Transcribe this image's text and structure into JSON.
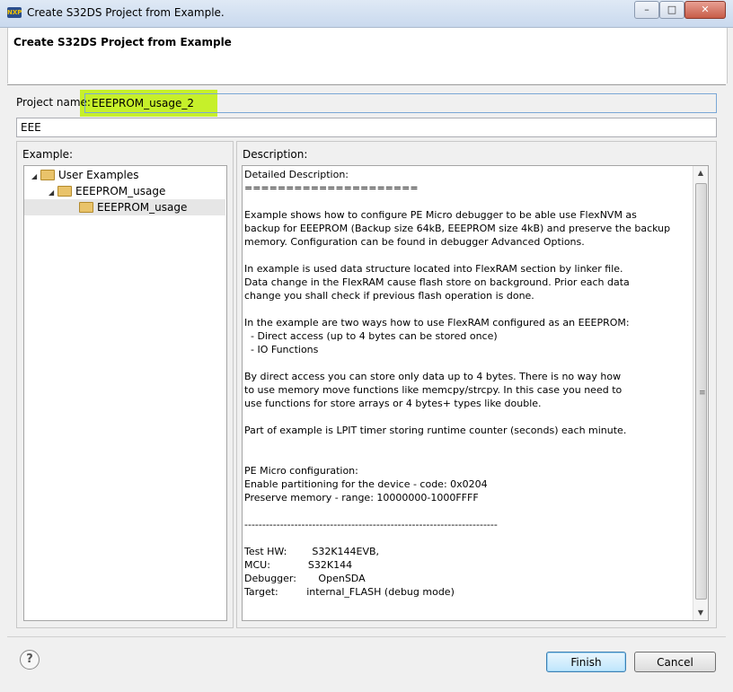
{
  "window": {
    "title": "Create S32DS Project from Example.",
    "app_icon_text": "NXP",
    "minimize": "–",
    "maximize": "□",
    "close": "✕"
  },
  "header": {
    "title": "Create S32DS Project from Example"
  },
  "form": {
    "project_name_label": "Project name:",
    "project_name_value": "EEEPROM_usage_2",
    "filter_value": "EEE"
  },
  "example": {
    "label": "Example:",
    "tree": [
      {
        "label": "User Examples",
        "arrow": "◢"
      },
      {
        "label": "EEEPROM_usage",
        "arrow": "◢"
      },
      {
        "label": "EEEPROM_usage",
        "arrow": ""
      }
    ]
  },
  "description": {
    "label": "Description:",
    "text": "Detailed Description:\n=====================\n\nExample shows how to configure PE Micro debugger to be able use FlexNVM as\nbackup for EEEPROM (Backup size 64kB, EEEPROM size 4kB) and preserve the backup\nmemory. Configuration can be found in debugger Advanced Options.\n\nIn example is used data structure located into FlexRAM section by linker file.\nData change in the FlexRAM cause flash store on background. Prior each data\nchange you shall check if previous flash operation is done.\n\nIn the example are two ways how to use FlexRAM configured as an EEEPROM:\n  - Direct access (up to 4 bytes can be stored once)\n  - IO Functions\n\nBy direct access you can store only data up to 4 bytes. There is no way how\nto use memory move functions like memcpy/strcpy. In this case you need to\nuse functions for store arrays or 4 bytes+ types like double.\n\nPart of example is LPIT timer storing runtime counter (seconds) each minute.\n\n\nPE Micro configuration:\nEnable partitioning for the device - code: 0x0204\nPreserve memory - range: 10000000-1000FFFF\n\n-----------------------------------------------------------------------\n\nTest HW:        S32K144EVB,\nMCU:            S32K144\nDebugger:       OpenSDA\nTarget:         internal_FLASH (debug mode)"
  },
  "buttons": {
    "help": "?",
    "finish": "Finish",
    "cancel": "Cancel"
  },
  "colors": {
    "highlight": "#c6f02a",
    "default_button": "#bee6fd"
  }
}
